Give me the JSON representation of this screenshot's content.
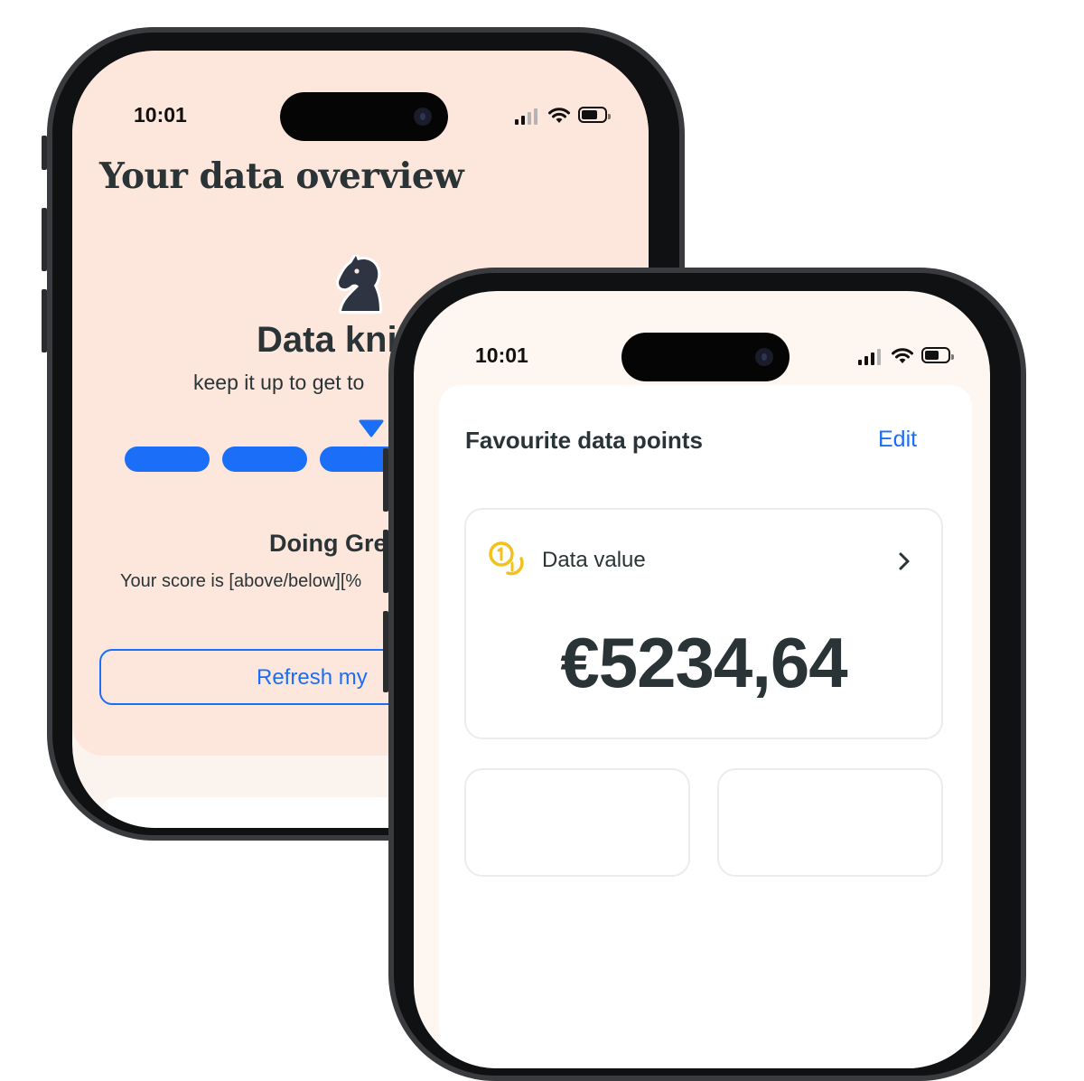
{
  "back_phone": {
    "status_time": "10:01",
    "page_title": "Your data overview",
    "level_icon": "chess-knight-icon",
    "level_title": "Data kni",
    "level_subtitle": "keep it up to get to",
    "progress_segments_filled": 4,
    "status_heading": "Doing Gre",
    "status_text": "Your score is [above/below][%",
    "refresh_button_label": "Refresh my"
  },
  "front_phone": {
    "status_time": "10:01",
    "section_title": "Favourite data points",
    "edit_label": "Edit",
    "data_value_icon": "coins-icon",
    "data_value_label": "Data value",
    "data_value_amount": "€5234,64"
  },
  "colors": {
    "accent_blue": "#1a6ef7",
    "peach_background": "#fde7dc",
    "title_text": "#2a3437",
    "coin_yellow": "#f2c21b"
  }
}
